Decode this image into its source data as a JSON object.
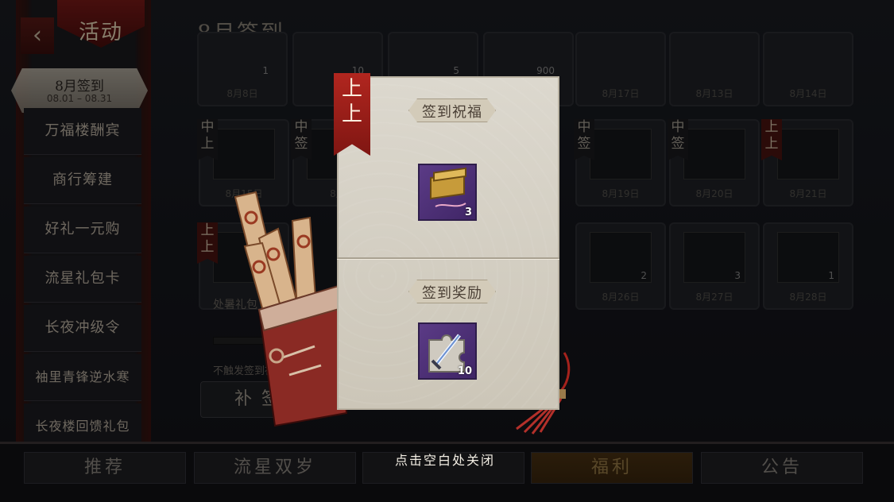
{
  "category": {
    "label": "活动"
  },
  "sidebar": {
    "selected": {
      "title": "8月签到",
      "range": "08.01 – 08.31"
    },
    "items": [
      {
        "label": "万福楼酬宾"
      },
      {
        "label": "商行筹建"
      },
      {
        "label": "好礼一元购"
      },
      {
        "label": "流星礼包卡"
      },
      {
        "label": "长夜冲级令"
      },
      {
        "label": "袖里青锋逆水寒"
      },
      {
        "label": "长夜楼回馈礼包"
      }
    ]
  },
  "main": {
    "title": "8月签到",
    "top_row_qty": [
      "1",
      "10",
      "5",
      "900"
    ],
    "row1_dates": [
      "8月8日",
      "8月17日",
      "8月13日",
      "8月14日"
    ],
    "row2_flags": [
      "中上",
      "中签",
      "中签",
      "中签",
      "上上"
    ],
    "row2_dates": [
      "8月15日",
      "8月",
      "8月19日",
      "8月20日",
      "8月21日"
    ],
    "row3_flag": "上上",
    "row3_label": "处暑礼包",
    "row3_qty": [
      "2",
      "3",
      "1"
    ],
    "row3_dates": [
      "8月26日",
      "8月27日",
      "8月28日"
    ],
    "no_trigger_text": "不触发签到祝福",
    "makeup_button": "补签"
  },
  "modal": {
    "fortune_tag": "上上",
    "blessing_header": "签到祝福",
    "blessing_item": {
      "icon": "golden-chest-icon",
      "count": "3"
    },
    "reward_header": "签到奖励",
    "reward_item": {
      "icon": "sword-puzzle-fragment-icon",
      "count": "10"
    }
  },
  "bottom_nav": {
    "tabs": [
      "推荐",
      "流星双岁",
      "",
      "福利",
      "公告"
    ],
    "close_hint": "点击空白处关闭"
  },
  "colors": {
    "fortune_red": "#b1261f",
    "item_purple": "#5b3b86",
    "paper": "#dcd8ce"
  }
}
